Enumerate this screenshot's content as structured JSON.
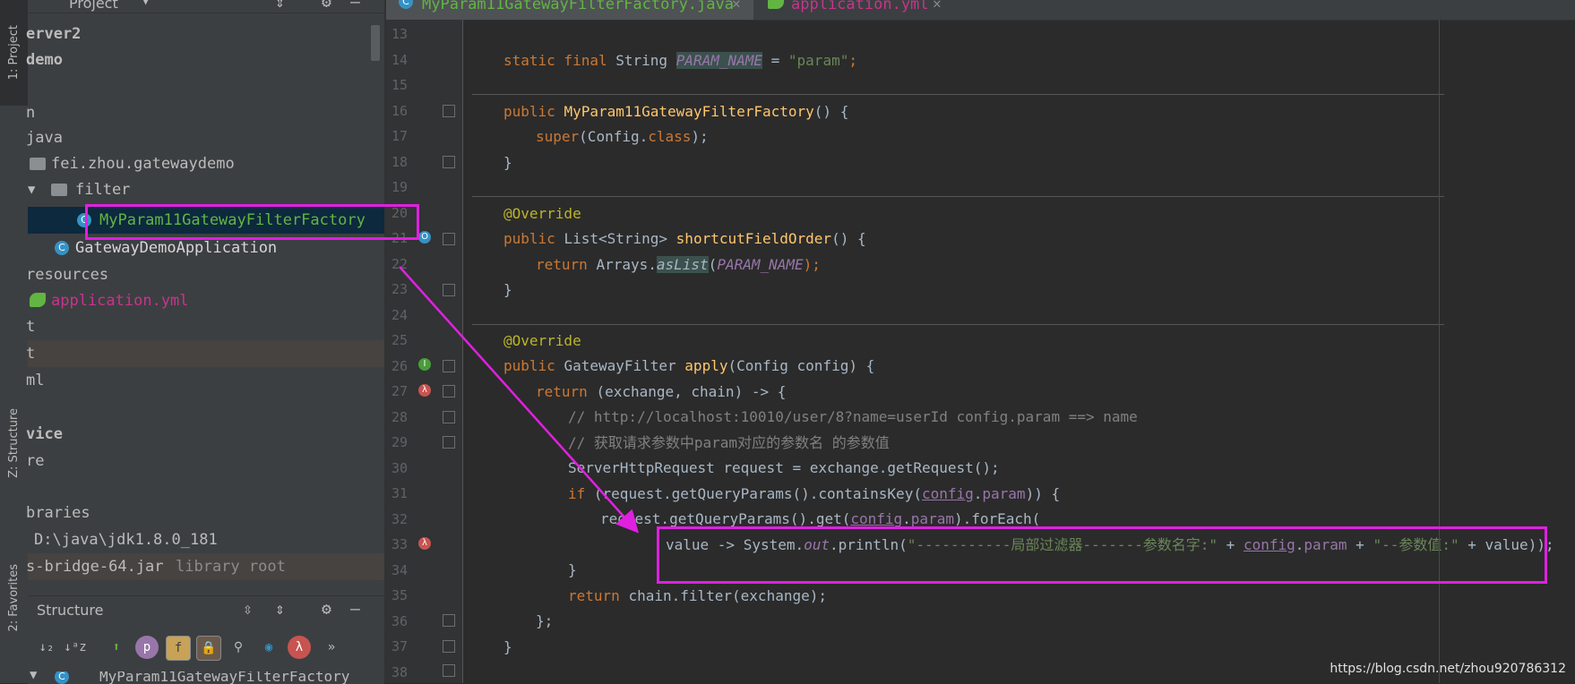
{
  "strip": {
    "project_tab": "1: Project",
    "structure_tab": "Z: Structure",
    "favorites_tab": "2: Favorites"
  },
  "project_panel": {
    "title": "Project",
    "tree": [
      {
        "label": "erver2"
      },
      {
        "label": "demo"
      },
      {
        "label": ""
      },
      {
        "label": "n"
      },
      {
        "label": "java"
      },
      {
        "label": "fei.zhou.gatewaydemo"
      },
      {
        "label": "filter"
      },
      {
        "label": "MyParam11GatewayFilterFactory"
      },
      {
        "label": "GatewayDemoApplication"
      },
      {
        "label": "resources"
      },
      {
        "label": "application.yml"
      },
      {
        "label": "t"
      },
      {
        "label": "t"
      },
      {
        "label": "ml"
      },
      {
        "label": ""
      },
      {
        "label": "vice"
      },
      {
        "label": "re"
      },
      {
        "label": ""
      },
      {
        "label": "braries"
      },
      {
        "label": "D:\\java\\jdk1.8.0_181"
      },
      {
        "label": "s-bridge-64.jar",
        "suffix": "library root"
      }
    ]
  },
  "structure_panel": {
    "title": "Structure",
    "root_item": "MyParam11GatewayFilterFactory",
    "buttons": [
      "↓₂",
      "↓ᵃz",
      "⬆",
      "p",
      "f",
      "🔒",
      "⚲",
      "◉",
      "λ",
      "»"
    ]
  },
  "editor": {
    "tabs": [
      {
        "label": "MyParam11GatewayFilterFactory.java",
        "active": true
      },
      {
        "label": "application.yml",
        "active": false
      }
    ],
    "line_numbers": [
      "13",
      "14",
      "15",
      "16",
      "17",
      "18",
      "19",
      "20",
      "21",
      "22",
      "23",
      "24",
      "25",
      "26",
      "27",
      "28",
      "29",
      "30",
      "31",
      "32",
      "33",
      "34",
      "35",
      "36",
      "37",
      "38"
    ],
    "lines": {
      "l14": {
        "a": "static final ",
        "b": "String ",
        "c": "PARAM_NAME",
        "d": " = ",
        "e": "\"param\"",
        "f": ";"
      },
      "l16": {
        "a": "public ",
        "b": "MyParam11GatewayFilterFactory",
        "c": "() {"
      },
      "l17": {
        "a": "super",
        "b": "(Config.",
        "c": "class",
        "d": ");"
      },
      "l18": "}",
      "l20": "@Override",
      "l21": {
        "a": "public ",
        "b": "List<String> ",
        "c": "shortcutFieldOrder",
        "d": "() {"
      },
      "l22": {
        "a": "return ",
        "b": "Arrays.",
        "c": "asList",
        "d": "(",
        "e": "PARAM_NAME",
        "f": ");"
      },
      "l23": "}",
      "l25": "@Override",
      "l26": {
        "a": "public ",
        "b": "GatewayFilter ",
        "c": "apply",
        "d": "(Config config) {"
      },
      "l27": {
        "a": "return ",
        "b": "(exchange, chain) -> {"
      },
      "l28": "// http://localhost:10010/user/8?name=userId config.param ==> name",
      "l29": "// 获取请求参数中param对应的参数名 的参数值",
      "l30": "ServerHttpRequest request = exchange.getRequest();",
      "l31": {
        "a": "if ",
        "b": "(request.getQueryParams().containsKey(",
        "c": "config",
        "d": ".",
        "e": "param",
        "f": ")) {"
      },
      "l32": {
        "a": "request.getQueryParams().get(",
        "b": "config",
        "c": ".",
        "d": "param",
        "e": ").forEach("
      },
      "l33": {
        "a": "value -> System.",
        "b": "out",
        "c": ".println(",
        "d": "\"-----------局部过滤器-------参数名字:\"",
        "e": " + ",
        "f": "config",
        "g": ".",
        "h": "param",
        "i": " + ",
        "j": "\"--参数值:\"",
        "k": " + value));"
      },
      "l34": "}",
      "l35": {
        "a": "return ",
        "b": "chain.filter(exchange);"
      },
      "l36": "};",
      "l37": "}"
    }
  },
  "watermark": "https://blog.csdn.net/zhou920786312",
  "colors": {
    "annotation": "#e020e0",
    "keyword": "#cc7832",
    "string": "#6a8759",
    "method": "#ffc66d"
  }
}
